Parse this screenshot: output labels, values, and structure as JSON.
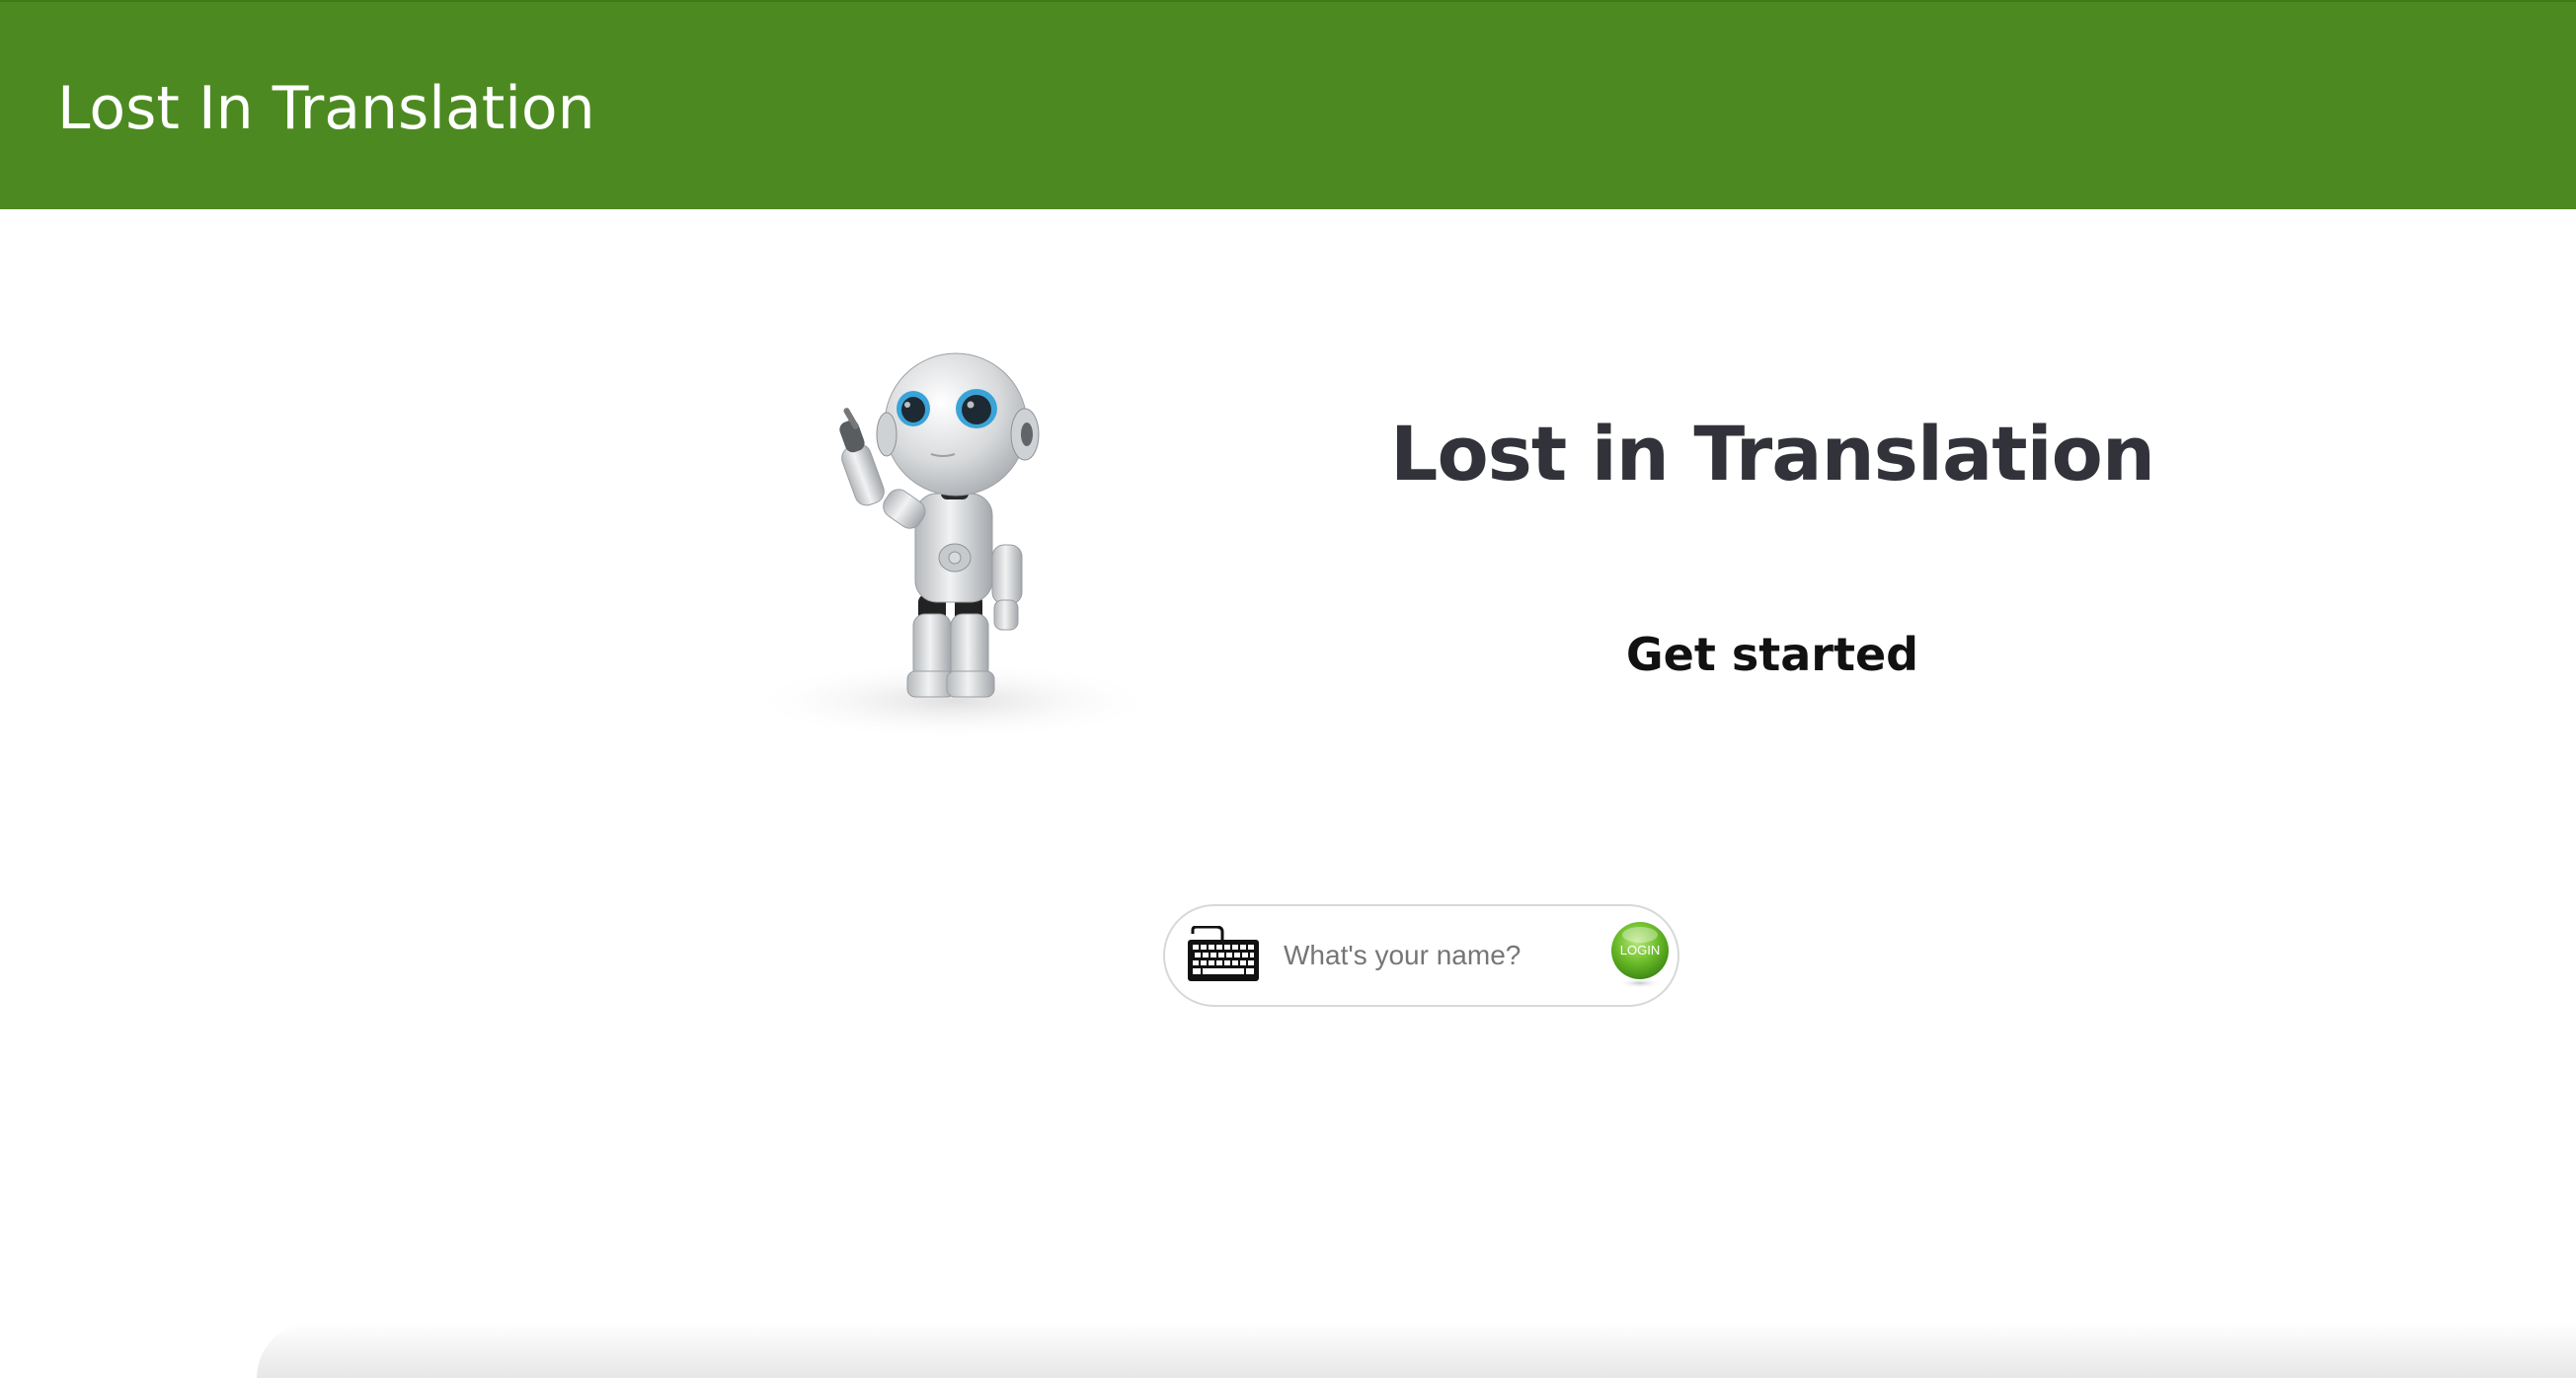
{
  "header": {
    "title": "Lost In Translation",
    "background_color": "#4c8a21"
  },
  "hero": {
    "title": "Lost in Translation",
    "subtitle": "Get started",
    "image_icon": "robot-illustration"
  },
  "login": {
    "input_value": "",
    "input_placeholder": "What's your name?",
    "keyboard_icon": "keyboard-icon",
    "button_label": "LOGIN",
    "button_color": "#6dbd2a"
  }
}
